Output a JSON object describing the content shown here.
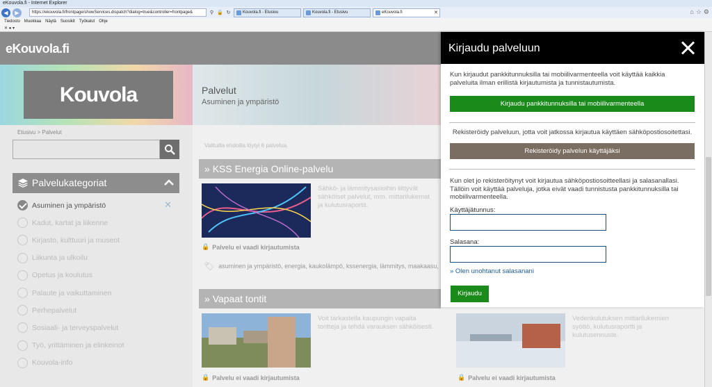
{
  "browser": {
    "title": "eKouvola.fi - Internet Explorer",
    "address": "https://ekouvola.fi/frontpage/showServices.dispatch?dialog=true&controller=frontpage&",
    "tabs": [
      {
        "label": "Kouvola.fi - Etusivu"
      },
      {
        "label": "Kouvola.fi - Etusivu"
      },
      {
        "label": "eKouvola.fi"
      }
    ],
    "menu": [
      "Tiedosto",
      "Muokkaa",
      "Näytä",
      "Suosikit",
      "Työkalut",
      "Ohje"
    ]
  },
  "header": {
    "logo": "eKouvola.fi"
  },
  "hero": {
    "brand": "Kouvola",
    "title": "Palvelut",
    "subtitle": "Asuminen ja ympäristö"
  },
  "sidebar": {
    "breadcrumb": "Etusivu > Palvelut",
    "categories_title": "Palvelukategoriat",
    "categories": [
      {
        "label": "Asuminen ja ympäristö",
        "selected": true
      },
      {
        "label": "Kadut, kartat ja liikenne",
        "selected": false
      },
      {
        "label": "Kirjasto, kulttuuri ja museot",
        "selected": false
      },
      {
        "label": "Liikunta ja ulkoilu",
        "selected": false
      },
      {
        "label": "Opetus ja koulutus",
        "selected": false
      },
      {
        "label": "Palaute ja vaikuttaminen",
        "selected": false
      },
      {
        "label": "Perhepalvelut",
        "selected": false
      },
      {
        "label": "Sosiaali- ja terveyspalvelut",
        "selected": false
      },
      {
        "label": "Työ, yrittäminen ja elinkeinot",
        "selected": false
      },
      {
        "label": "Kouvola-info",
        "selected": false
      }
    ]
  },
  "main": {
    "result_count": "Valituilla ehdoilla löytyi 6 palvelua.",
    "cards": [
      {
        "title": "KSS Energia Online-palvelu",
        "text": "Sähkö- ja lämmitysasioihin liittyvät sähköiset palvelut, mm. mittarilukemat ja kulutusraportit.",
        "lock": "Palvelu ei vaadi kirjautumista",
        "tags": "asuminen ja ympäristö, energia, kaukolämpö, kssenergia, lämmitys, maakaasu,"
      },
      {
        "title": "Vapaat tontit",
        "text": "Voit tarkastella kaupungin vapaita tontteja ja tehdä varauksen sähköisesti.",
        "lock": "Palvelu ei vaadi kirjautumista"
      },
      {
        "text": "Vedenkulutuksen mittarilukemien syöttö, kulutusraportti ja kulutusennuste.",
        "lock": "Palvelu ei vaadi kirjautumista"
      }
    ]
  },
  "login": {
    "title": "Kirjaudu palveluun",
    "intro": "Kun kirjaudut pankkitunnuksilla tai mobiilivarmenteella voit käyttää kaikkia palveluita ilman erillistä kirjautumista ja tunnistautumista.",
    "bank_button": "Kirjaudu pankkitunnuksilla tai mobiilivarmenteella",
    "register_text": "Rekisteröidy palveluun, jotta voit jatkossa kirjautua käyttäen sähköpostiosoitettasi.",
    "register_button": "Rekisteröidy palvelun käyttäjäksi",
    "email_text": "Kun olet jo rekisteröitynyt voit kirjautua sähköpostiosoitteellasi ja salasanallasi. Tällöin voit käyttää palveluja, jotka eivät vaadi tunnistusta pankkitunnuksilla tai mobiilivarmenteella.",
    "username_label": "Käyttäjätunnus:",
    "username_value": "",
    "password_label": "Salasana:",
    "password_value": "",
    "forgot": "» Olen unohtanut salasanani",
    "login_button": "Kirjaudu"
  },
  "colors": {
    "green": "#1a8a1a",
    "brown_grey": "#7a6d61",
    "link": "#1d5d9a"
  }
}
